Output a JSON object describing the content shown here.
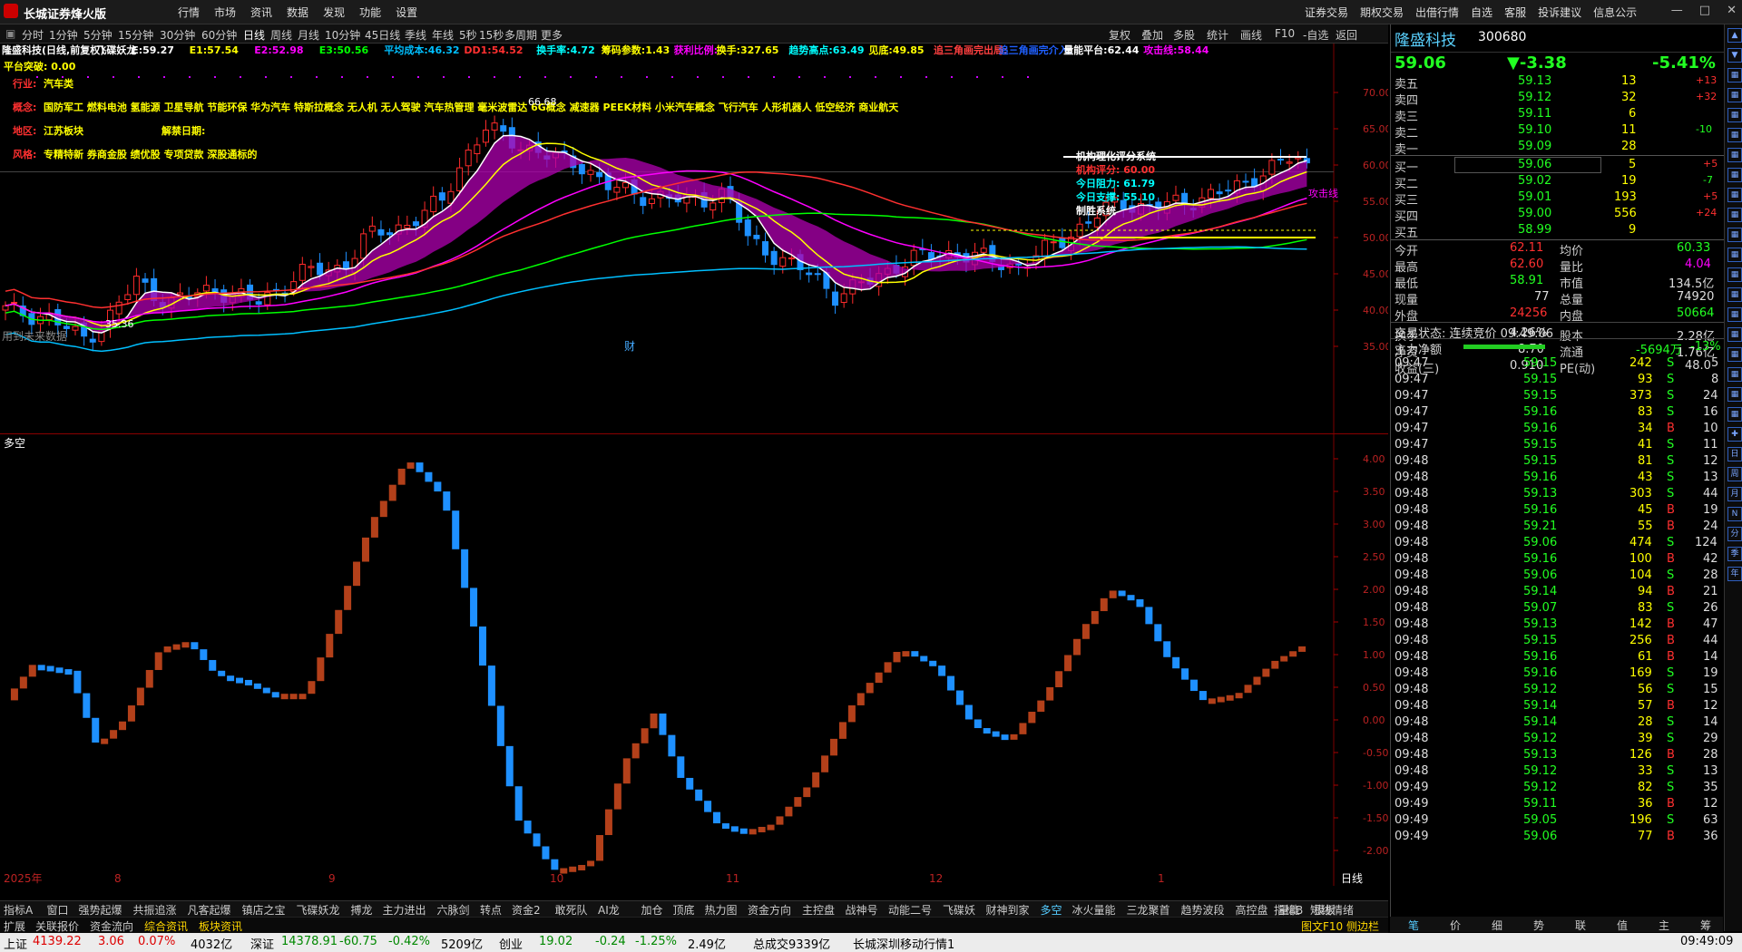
{
  "app": {
    "title": "长城证券烽火版"
  },
  "menu": [
    "行情",
    "市场",
    "资讯",
    "数据",
    "发现",
    "功能",
    "设置"
  ],
  "top_right_links": [
    "证券交易",
    "期权交易",
    "出借行情",
    "自选",
    "客服",
    "投诉建议",
    "信息公示"
  ],
  "window_buttons": [
    "—",
    "□",
    "✕"
  ],
  "periods": [
    "分时",
    "1分钟",
    "5分钟",
    "15分钟",
    "30分钟",
    "60分钟",
    "日线",
    "周线",
    "月线",
    "10分钟",
    "45日线",
    "季线",
    "年线",
    "5秒",
    "15秒",
    "多周期",
    "更多"
  ],
  "active_period": "日线",
  "chart_tools": [
    "复权",
    "叠加",
    "多股",
    "统计",
    "画线",
    "F10",
    "-自选",
    "返回"
  ],
  "stock": {
    "name": "隆盛科技",
    "code": "300680",
    "price": "59.06",
    "change": "▼-3.38",
    "pct": "-5.41%"
  },
  "main_indicator_line": [
    {
      "t": "隆盛科技(日线,前复权)",
      "c": "#ffffff"
    },
    {
      "t": "飞碟妖龙",
      "c": "#ffffff"
    },
    {
      "t": "E:59.27",
      "c": "#ffffff"
    },
    {
      "t": "E1:57.54",
      "c": "#ffff00"
    },
    {
      "t": "E2:52.98",
      "c": "#ff00ff"
    },
    {
      "t": "E3:50.56",
      "c": "#00ff00"
    },
    {
      "t": "平均成本:46.32",
      "c": "#00bfff"
    },
    {
      "t": "DD1:54.52",
      "c": "#ff3030"
    },
    {
      "t": "换手率:4.72",
      "c": "#00ffff"
    },
    {
      "t": "筹码参数:1.43",
      "c": "#ffff00"
    },
    {
      "t": "获利比例:",
      "c": "#ff00ff"
    },
    {
      "t": "换手:327.65",
      "c": "#ffff00"
    },
    {
      "t": "趋势高点:63.49",
      "c": "#00ffff"
    },
    {
      "t": "见底:49.85",
      "c": "#ffff00"
    },
    {
      "t": "追三角画完出局:",
      "c": "#ff4040"
    },
    {
      "t": "追三角画完介入:",
      "c": "#2060ff"
    },
    {
      "t": "量能平台:62.44",
      "c": "#ffffff"
    },
    {
      "t": "攻击线:58.44",
      "c": "#ff00ff"
    }
  ],
  "platform_break": "平台突破: 0.00",
  "info_lines": [
    {
      "key": "行业:",
      "val": "汽车类"
    },
    {
      "key": "概念:",
      "val": "国防军工 燃料电池 氢能源 卫星导航 节能环保 华为汽车 特斯拉概念 无人机 无人驾驶 汽车热管理 毫米波雷达 6G概念 减速器 PEEK材料 小米汽车概念 飞行汽车 人形机器人 低空经济 商业航天"
    },
    {
      "key": "地区:",
      "val": "江苏板块",
      "extra": "解禁日期:"
    },
    {
      "key": "风格:",
      "val": "专精特新 券商金股 绩优股 专项贷款 深股通标的"
    }
  ],
  "institution_box": [
    "机构理化评分系统",
    "机构评分: 60.00",
    "今日阻力: 61.79",
    "今日支撑: 55.10",
    "制胜系统"
  ],
  "future_data_note": "用到未来数据",
  "fin_marker": "财",
  "price_axis": [
    "70.00",
    "65.00",
    "60.00",
    "55.00",
    "50.00",
    "45.00",
    "40.00",
    "35.00"
  ],
  "chart_labels": {
    "high": "66.68",
    "low": "35.36",
    "attack": "攻击线",
    "cheng": "成"
  },
  "lower_title": "多空",
  "lower_axis": [
    "4.00",
    "3.50",
    "3.00",
    "2.50",
    "2.00",
    "1.50",
    "1.00",
    "0.50",
    "0.00",
    "-0.50",
    "-1.00",
    "-1.50",
    "-2.00"
  ],
  "date_axis": [
    "2025年",
    "8",
    "9",
    "10",
    "11",
    "12",
    "1"
  ],
  "lower_period": "日线",
  "indicator_tabs": [
    "指标A",
    "窗口",
    "强势起爆",
    "共振追涨",
    "凡客起爆",
    "镇店之宝",
    "飞碟妖龙",
    "搏龙",
    "主力进出",
    "六脉剑",
    "转点",
    "资金2",
    "敢死队",
    "AI龙",
    "加仓",
    "顶底",
    "热力图",
    "资金方向",
    "主控盘",
    "战神号",
    "动能二号",
    "飞碟妖",
    "财神到家",
    "多空",
    "冰火量能",
    "三龙聚首",
    "趋势波段",
    "高控盘",
    "量能",
    "短线情绪"
  ],
  "indicator_tabs_right": [
    "指标B",
    "模板"
  ],
  "bottom_tabs": [
    "扩展",
    "关联报价",
    "资金流向",
    "综合资讯",
    "板块资讯"
  ],
  "bottom_right_note": "图文F10 侧边栏",
  "order_book": {
    "asks": [
      {
        "l": "卖五",
        "p": "59.13",
        "v": "13",
        "d": "+13"
      },
      {
        "l": "卖四",
        "p": "59.12",
        "v": "32",
        "d": "+32"
      },
      {
        "l": "卖三",
        "p": "59.11",
        "v": "6",
        "d": ""
      },
      {
        "l": "卖二",
        "p": "59.10",
        "v": "11",
        "d": "-10"
      },
      {
        "l": "卖一",
        "p": "59.09",
        "v": "28",
        "d": ""
      }
    ],
    "bids": [
      {
        "l": "买一",
        "p": "59.06",
        "v": "5",
        "d": "+5"
      },
      {
        "l": "买二",
        "p": "59.02",
        "v": "19",
        "d": "-7"
      },
      {
        "l": "买三",
        "p": "59.01",
        "v": "193",
        "d": "+5"
      },
      {
        "l": "买四",
        "p": "59.00",
        "v": "556",
        "d": "+24"
      },
      {
        "l": "买五",
        "p": "58.99",
        "v": "9",
        "d": ""
      }
    ]
  },
  "stats": [
    [
      "今开",
      "62.11",
      "均价",
      "60.33"
    ],
    [
      "最高",
      "62.60",
      "量比",
      "4.04"
    ],
    [
      "最低",
      "58.91",
      "市值",
      "134.5亿"
    ],
    [
      "现量",
      "77",
      "总量",
      "74920"
    ],
    [
      "外盘",
      "24256",
      "内盘",
      "50664"
    ],
    [
      "换手",
      "4.26%",
      "股本",
      "2.28亿"
    ],
    [
      "净资",
      "8.70",
      "流通",
      "1.76亿"
    ],
    [
      "收益(三)",
      "0.910",
      "PE(动)",
      "48.0"
    ]
  ],
  "trade_status": "交易状态: 连续竞价 09:49:06",
  "main_net": {
    "label": "主力净额",
    "value": "-5694万",
    "pct": "-13%"
  },
  "ticks": [
    [
      "09:47",
      "59.15",
      "242",
      "S",
      "5"
    ],
    [
      "09:47",
      "59.15",
      "93",
      "S",
      "8"
    ],
    [
      "09:47",
      "59.15",
      "373",
      "S",
      "24"
    ],
    [
      "09:47",
      "59.16",
      "83",
      "S",
      "16"
    ],
    [
      "09:47",
      "59.16",
      "34",
      "B",
      "10"
    ],
    [
      "09:47",
      "59.15",
      "41",
      "S",
      "11"
    ],
    [
      "09:48",
      "59.15",
      "81",
      "S",
      "12"
    ],
    [
      "09:48",
      "59.16",
      "43",
      "S",
      "13"
    ],
    [
      "09:48",
      "59.13",
      "303",
      "S",
      "44"
    ],
    [
      "09:48",
      "59.16",
      "45",
      "B",
      "19"
    ],
    [
      "09:48",
      "59.21",
      "55",
      "B",
      "24"
    ],
    [
      "09:48",
      "59.06",
      "474",
      "S",
      "124"
    ],
    [
      "09:48",
      "59.16",
      "100",
      "B",
      "42"
    ],
    [
      "09:48",
      "59.06",
      "104",
      "S",
      "28"
    ],
    [
      "09:48",
      "59.14",
      "94",
      "B",
      "21"
    ],
    [
      "09:48",
      "59.07",
      "83",
      "S",
      "26"
    ],
    [
      "09:48",
      "59.13",
      "142",
      "B",
      "47"
    ],
    [
      "09:48",
      "59.15",
      "256",
      "B",
      "44"
    ],
    [
      "09:48",
      "59.16",
      "61",
      "B",
      "14"
    ],
    [
      "09:48",
      "59.16",
      "169",
      "S",
      "19"
    ],
    [
      "09:48",
      "59.12",
      "56",
      "S",
      "15"
    ],
    [
      "09:48",
      "59.14",
      "57",
      "B",
      "12"
    ],
    [
      "09:48",
      "59.14",
      "28",
      "S",
      "14"
    ],
    [
      "09:48",
      "59.12",
      "39",
      "S",
      "29"
    ],
    [
      "09:48",
      "59.13",
      "126",
      "B",
      "28"
    ],
    [
      "09:48",
      "59.12",
      "33",
      "S",
      "13"
    ],
    [
      "09:49",
      "59.12",
      "82",
      "S",
      "35"
    ],
    [
      "09:49",
      "59.11",
      "36",
      "B",
      "12"
    ],
    [
      "09:49",
      "59.05",
      "196",
      "S",
      "63"
    ],
    [
      "09:49",
      "59.06",
      "77",
      "B",
      "36"
    ]
  ],
  "right_tabs": [
    "笔",
    "价",
    "细",
    "势",
    "联",
    "值",
    "主",
    "筹"
  ],
  "sidebar_icons": [
    "▲",
    "▼",
    "▦",
    "▦",
    "▦",
    "▦",
    "▦",
    "▦",
    "▦",
    "▦",
    "▦",
    "▦",
    "▦",
    "▦",
    "▦",
    "▦",
    "▦",
    "▦",
    "▦",
    "▦",
    "✚",
    "日",
    "周",
    "月",
    "N",
    "分",
    "季",
    "年"
  ],
  "status_bar": {
    "sh_label": "上证",
    "sh_val": "4139.22",
    "sh_chg": "3.06",
    "sh_pct": "0.07%",
    "sh_amt": "4032亿",
    "sz_label": "深证",
    "sz_val": "14378.91",
    "sz_chg": "-60.75",
    "sz_pct": "-0.42%",
    "sz_amt": "5209亿",
    "cy_label": "创业",
    "cy_val": "19.02",
    "cy_chg": "-0.24",
    "cy_pct": "-1.25%",
    "cy_amt": "2.49亿",
    "total": "总成交9339亿",
    "conn": "长城深圳移动行情1",
    "time": "09:49:09"
  }
}
